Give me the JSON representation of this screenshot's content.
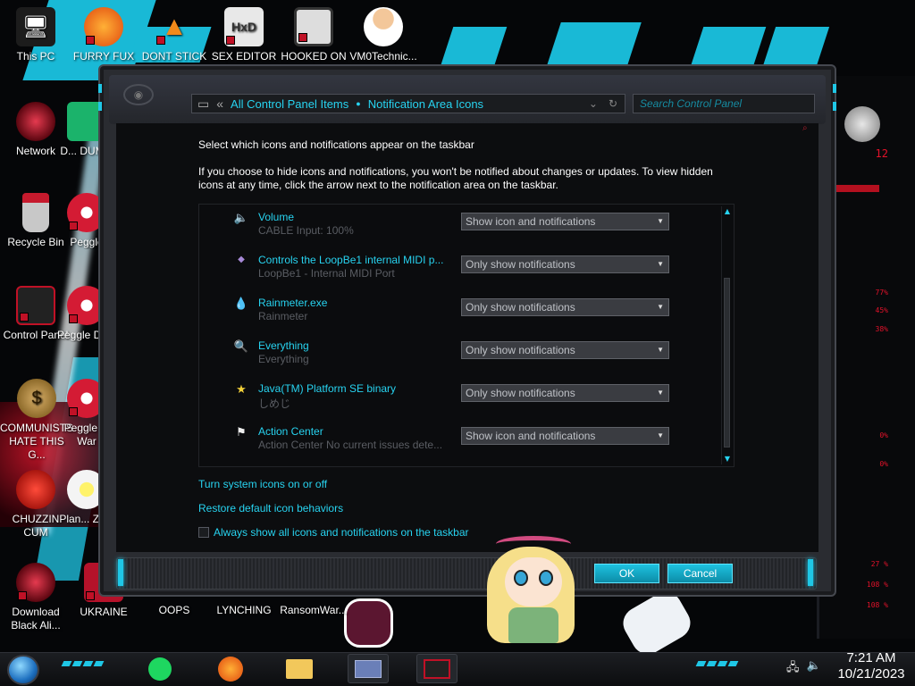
{
  "desktop": {
    "icons": [
      {
        "label": "This PC",
        "icon": "this-pc-icon"
      },
      {
        "label": "FURRY FUX",
        "icon": "firefox-icon"
      },
      {
        "label": "DONT STICK",
        "icon": "vlc-cone-icon"
      },
      {
        "label": "SEX EDITOR",
        "icon": "hxd-editor-icon"
      },
      {
        "label": "HOOKED ON",
        "icon": "maze-game-icon"
      },
      {
        "label": "VM0Technic...",
        "icon": "doctor-avatar-icon"
      },
      {
        "label": "Network",
        "icon": "network-icon"
      },
      {
        "label": "D... DUM...",
        "icon": "shortcut-icon"
      },
      {
        "label": "Recycle Bin",
        "icon": "recycle-bin-icon"
      },
      {
        "label": "Peggle",
        "icon": "peggle-icon"
      },
      {
        "label": "Control Panel",
        "icon": "control-panel-icon"
      },
      {
        "label": "Peggle De...",
        "icon": "peggle-deluxe-icon"
      },
      {
        "label": "COMMUNISTS HATE THIS G...",
        "icon": "money-bag-icon"
      },
      {
        "label": "Peggle of War",
        "icon": "peggle-nights-icon"
      },
      {
        "label": "CHUZZIN CUM",
        "icon": "chuzzle-icon"
      },
      {
        "label": "Plan... Zo...",
        "icon": "plants-zombies-icon"
      },
      {
        "label": "Download Black Ali...",
        "icon": "download-icon"
      },
      {
        "label": "UKRAINE",
        "icon": "shortcut-icon"
      },
      {
        "label": "OOPS",
        "icon": "shortcut-icon"
      },
      {
        "label": "LYNCHING",
        "icon": "shortcut-icon"
      },
      {
        "label": "RansomWar...",
        "icon": "shortcut-icon"
      }
    ],
    "readouts": [
      "12",
      "77%",
      "45%",
      "38%",
      "0%",
      "0%",
      "27 %",
      "108 %",
      "108 %"
    ]
  },
  "window": {
    "breadcrumb": {
      "root": "All Control Panel Items",
      "current": "Notification Area Icons"
    },
    "search_placeholder": "Search Control Panel",
    "heading": "Select which icons and notifications appear on the taskbar",
    "description": "If you choose to hide icons and notifications, you won't be notified about changes or updates. To view hidden icons at any time, click the arrow next to the notification area on the taskbar.",
    "rows": [
      {
        "name": "Volume",
        "sub": "CABLE Input: 100%",
        "behavior": "Show icon and notifications",
        "icon": "speaker-icon"
      },
      {
        "name": "Controls the LoopBe1 internal MIDI p...",
        "sub": "LoopBe1 - Internal MIDI Port",
        "behavior": "Only show notifications",
        "icon": "midi-icon"
      },
      {
        "name": "Rainmeter.exe",
        "sub": "Rainmeter",
        "behavior": "Only show notifications",
        "icon": "droplet-icon"
      },
      {
        "name": "Everything",
        "sub": "Everything",
        "behavior": "Only show notifications",
        "icon": "magnifier-icon"
      },
      {
        "name": "Java(TM) Platform SE binary",
        "sub": "しめじ",
        "behavior": "Only show notifications",
        "icon": "star-icon"
      },
      {
        "name": "Action Center",
        "sub": "Action Center  No current issues dete...",
        "behavior": "Show icon and notifications",
        "icon": "flag-icon"
      }
    ],
    "links": {
      "system_icons": "Turn system icons on or off",
      "restore": "Restore default icon behaviors"
    },
    "always_show_label": "Always show all icons and notifications on the taskbar",
    "ok_label": "OK",
    "cancel_label": "Cancel"
  },
  "taskbar": {
    "time": "7:21 AM",
    "date": "10/21/2023"
  },
  "colors": {
    "accent": "#27d3f0",
    "window_bg": "#2a2c31",
    "content_bg": "#0c0d0f",
    "alert_red": "#e3122a"
  }
}
